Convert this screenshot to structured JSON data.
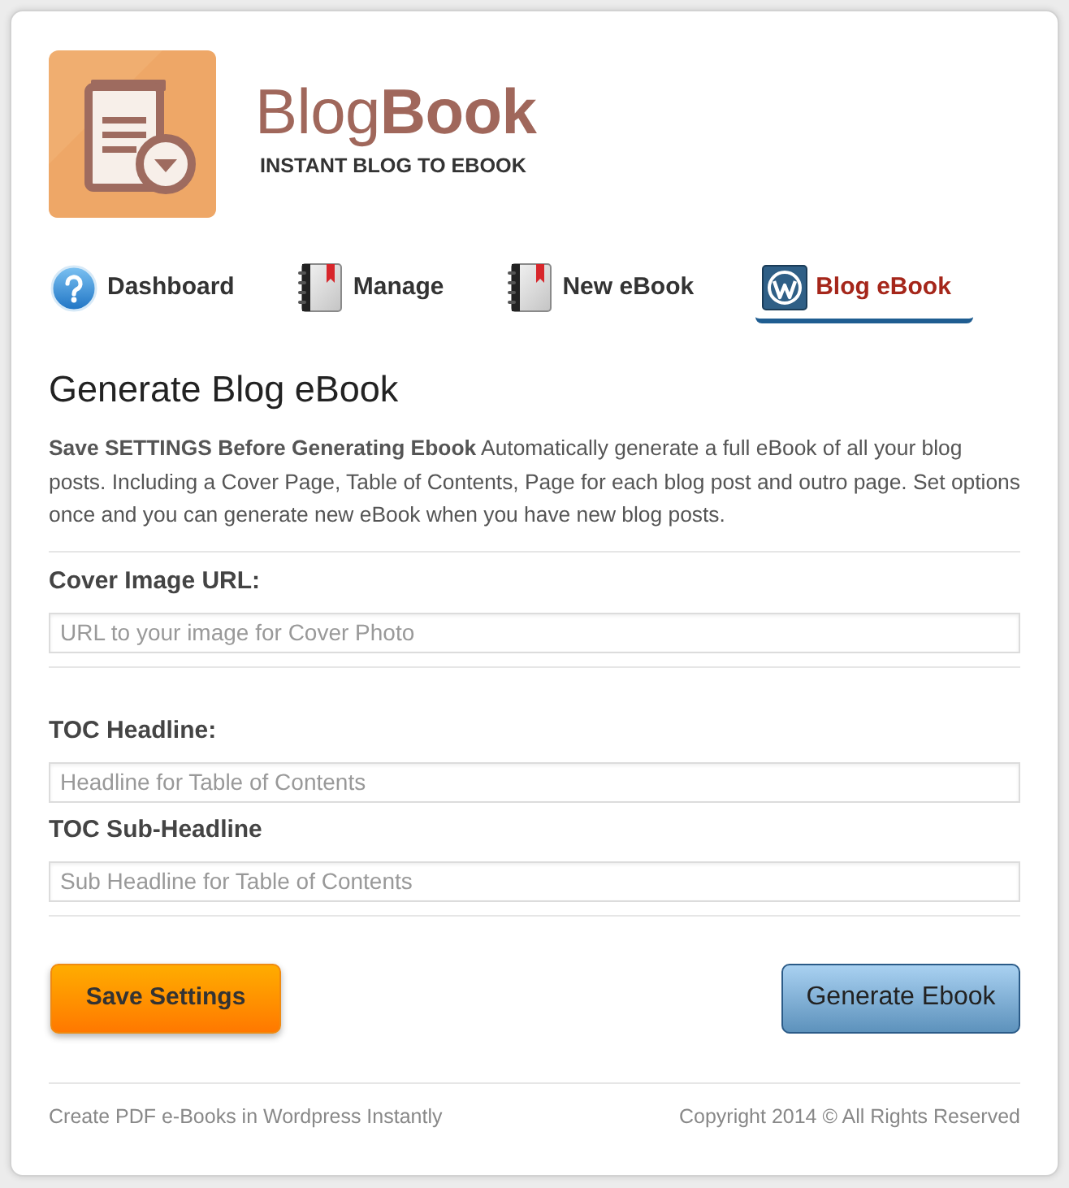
{
  "logo": {
    "title": "Blog**Book**",
    "tagline": "INSTANT BLOG TO EBOOK"
  },
  "tabs": [
    {
      "label": "Dashboard",
      "kind": "help",
      "selected": false
    },
    {
      "label": "Manage",
      "kind": "notebook",
      "selected": false
    },
    {
      "label": "New eBook",
      "kind": "notebook",
      "selected": false
    },
    {
      "label": "Blog eBook",
      "kind": "w-logo",
      "selected": true
    }
  ],
  "heading": "Generate Blog eBook",
  "intro": "**Save SETTINGS Before Generating Ebook** Automatically generate a full eBook of all your blog posts. Including a Cover Page, Table of Contents, Page for each blog post and outro page. Set options once and you can generate new eBook when you have new blog posts.",
  "sections": [
    {
      "fields": [
        {
          "label": "Cover Image URL:",
          "placeholder": "URL to your image for Cover Photo"
        }
      ]
    },
    {
      "fields": [
        {
          "label": "TOC Headline:",
          "placeholder": "Headline for Table of Contents"
        },
        {
          "label": "TOC Sub-Headline",
          "placeholder": "Sub Headline for Table of Contents"
        }
      ]
    }
  ],
  "buttons": [
    {
      "label": "Save Settings",
      "kind": "primary"
    },
    {
      "label": "Generate Ebook",
      "kind": "secondary"
    }
  ],
  "footer": {
    "left": "Create PDF e-Books in Wordpress Instantly",
    "right": "Copyright 2014 © All Rights Reserved"
  }
}
